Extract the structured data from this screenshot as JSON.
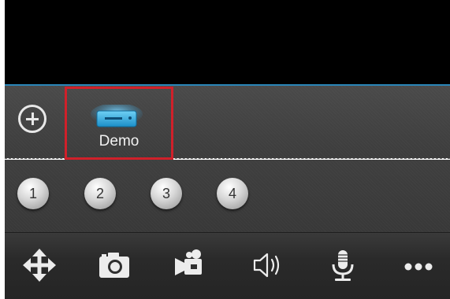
{
  "device": {
    "name": "Demo"
  },
  "channels": [
    "1",
    "2",
    "3",
    "4"
  ],
  "toolbar": {
    "icons": [
      "move-icon",
      "camera-icon",
      "video-record-icon",
      "speaker-icon",
      "microphone-icon",
      "more-icon"
    ]
  },
  "colors": {
    "selection": "#d0202a",
    "accent": "#2a86b8",
    "device_icon": "#3fb8ea"
  }
}
